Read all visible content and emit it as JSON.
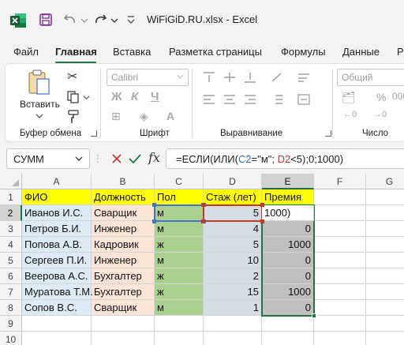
{
  "window": {
    "filename": "WiFiGiD.RU.xlsx",
    "title": "WiFiGiD.RU.xlsx  -  Excel",
    "accent": "#217346"
  },
  "tabs": [
    "Файл",
    "Главная",
    "Вставка",
    "Разметка страницы",
    "Формулы",
    "Данные",
    "Р"
  ],
  "active_tab": "Главная",
  "ribbon": {
    "groups": {
      "clipboard": "Буфер обмена",
      "font": "Шрифт",
      "alignment": "Выравнивание",
      "number": "Число"
    },
    "paste_label": "Вставить",
    "font_name": "Calibri",
    "number_format": "Общий"
  },
  "formula_bar": {
    "name_box": "СУММ",
    "fx": "fx",
    "formula_prefix": "=ЕСЛИ(ИЛИ(",
    "ref1": "C2",
    "formula_mid": "=\"м\"; ",
    "ref2": "D2",
    "formula_suffix": "<5);0;1000)"
  },
  "grid": {
    "columns": [
      "A",
      "B",
      "C",
      "D",
      "E",
      "F",
      "G"
    ],
    "selected_column": "E",
    "rows": [
      "1",
      "2",
      "3",
      "4",
      "5",
      "6",
      "7",
      "8",
      "9",
      "10"
    ],
    "selected_row": "2",
    "header": [
      "ФИО",
      "Должность",
      "Пол",
      "Стаж (лет)",
      "Премия"
    ],
    "data": [
      [
        "Иванов И.С.",
        "Сварщик",
        "м",
        "5",
        "1000)"
      ],
      [
        "Петров Б.И.",
        "Инженер",
        "м",
        "4",
        "0"
      ],
      [
        "Попова А.В.",
        "Кадровик",
        "ж",
        "5",
        "1000"
      ],
      [
        "Сергеев П.И.",
        "Инженер",
        "м",
        "10",
        "0"
      ],
      [
        "Веерова А.С.",
        "Бухгалтер",
        "ж",
        "2",
        "0"
      ],
      [
        "Муратова Т.М.",
        "Бухгалтер",
        "ж",
        "15",
        "1000"
      ],
      [
        "Сопов В.С.",
        "Сварщик",
        "м",
        "1",
        "0"
      ]
    ],
    "fill_colors": {
      "header": "#ffff00",
      "col_a": "#ddebf7",
      "col_b": "#fce4d6",
      "col_c": "#a9d08e",
      "col_d": "#d6dce4",
      "col_e": "#bfbfbf"
    }
  }
}
